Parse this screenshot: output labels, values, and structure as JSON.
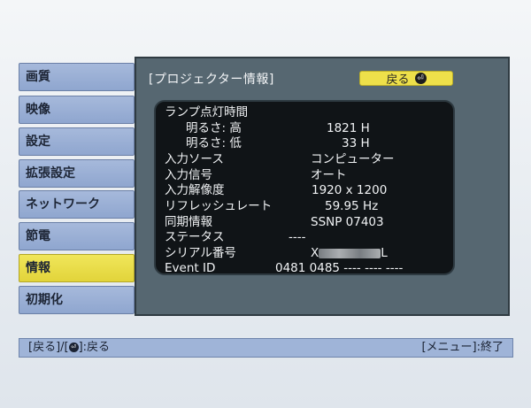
{
  "menu": {
    "items": [
      {
        "label": "画質"
      },
      {
        "label": "映像"
      },
      {
        "label": "設定"
      },
      {
        "label": "拡張設定"
      },
      {
        "label": "ネットワーク"
      },
      {
        "label": "節電"
      },
      {
        "label": "情報"
      },
      {
        "label": "初期化"
      }
    ],
    "selected": "情報"
  },
  "panel": {
    "title": "[プロジェクター情報]",
    "back_button": "戻る"
  },
  "info": {
    "lamp_hours_label": "ランプ点灯時間",
    "brightness_high_label": "明るさ: 高",
    "brightness_high_value": "1821 H",
    "brightness_low_label": "明るさ: 低",
    "brightness_low_value": "33 H",
    "input_source_label": "入力ソース",
    "input_source_value": "コンピューター",
    "input_signal_label": "入力信号",
    "input_signal_value": "オート",
    "resolution_label": "入力解像度",
    "resolution_value": "1920 x 1200",
    "refresh_label": "リフレッシュレート",
    "refresh_value": "59.95 Hz",
    "sync_label": "同期情報",
    "sync_value": "SSNP 07403",
    "status_label": "ステータス",
    "status_value": "----",
    "serial_label": "シリアル番号",
    "serial_prefix": "X",
    "serial_suffix": "L",
    "event_label": "Event ID",
    "event_value": "0481 0485 ---- ---- ----"
  },
  "footer": {
    "left_a": "[戻る]/[",
    "left_b": "]:戻る",
    "right": "[メニュー]:終了"
  },
  "colors": {
    "panel": "#566771",
    "info_box": "#101417",
    "selected": "#eee04a",
    "menu": "#9fb4d8"
  }
}
